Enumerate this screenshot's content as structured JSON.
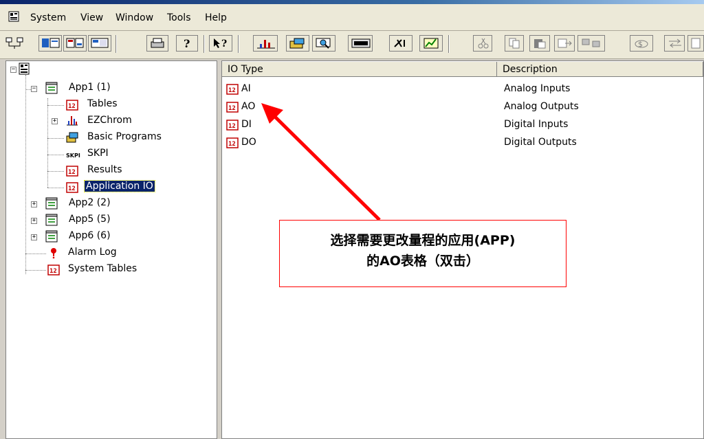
{
  "menu": {
    "items": [
      "System",
      "View",
      "Window",
      "Tools",
      "Help"
    ]
  },
  "tree": {
    "root_label": "",
    "app1": {
      "label": "App1 (1)",
      "children": [
        "Tables",
        "EZChrom",
        "Basic Programs",
        "SKPI",
        "Results",
        "Application IO"
      ]
    },
    "others": [
      "App2 (2)",
      "App5 (5)",
      "App6 (6)",
      "Alarm Log",
      "System Tables"
    ],
    "selected": "Application IO"
  },
  "list": {
    "columns": [
      "IO Type",
      "Description"
    ],
    "rows": [
      {
        "type": "AI",
        "description": "Analog Inputs"
      },
      {
        "type": "AO",
        "description": "Analog Outputs"
      },
      {
        "type": "DI",
        "description": "Digital Inputs"
      },
      {
        "type": "DO",
        "description": "Digital Outputs"
      }
    ]
  },
  "annotation": {
    "line1": "选择需要更改量程的应用(APP)",
    "line2": "的AO表格（双击）",
    "color": "#ff0000"
  },
  "icons": {
    "table_icon_text": "12"
  },
  "colors": {
    "selection": "#0a246a",
    "chrome": "#ece9d8",
    "arrow": "#ff0000"
  }
}
